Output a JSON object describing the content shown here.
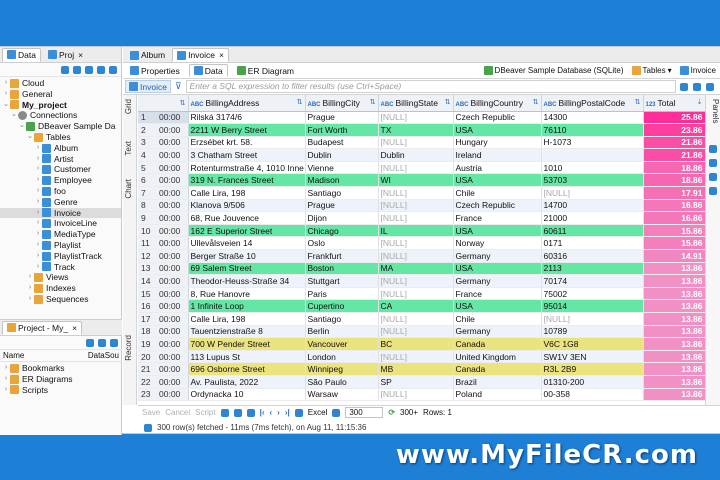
{
  "left_panel": {
    "tabs": [
      {
        "label": "Data"
      },
      {
        "label": "Proj"
      }
    ],
    "tree": [
      {
        "label": "Cloud",
        "indent": 0,
        "arrow": "›",
        "icon": "folder"
      },
      {
        "label": "General",
        "indent": 0,
        "arrow": "›",
        "icon": "folder"
      },
      {
        "label": "My_project",
        "indent": 0,
        "arrow": "⌄",
        "icon": "folder",
        "bold": true
      },
      {
        "label": "Connections",
        "indent": 1,
        "arrow": "⌄",
        "icon": "db"
      },
      {
        "label": "DBeaver Sample Da",
        "indent": 2,
        "arrow": "⌄",
        "icon": "green"
      },
      {
        "label": "Tables",
        "indent": 3,
        "arrow": "⌄",
        "icon": "folder"
      },
      {
        "label": "Album",
        "indent": 4,
        "arrow": "›",
        "icon": "table"
      },
      {
        "label": "Artist",
        "indent": 4,
        "arrow": "›",
        "icon": "table"
      },
      {
        "label": "Customer",
        "indent": 4,
        "arrow": "›",
        "icon": "table"
      },
      {
        "label": "Employee",
        "indent": 4,
        "arrow": "›",
        "icon": "table"
      },
      {
        "label": "foo",
        "indent": 4,
        "arrow": "›",
        "icon": "table"
      },
      {
        "label": "Genre",
        "indent": 4,
        "arrow": "›",
        "icon": "table"
      },
      {
        "label": "Invoice",
        "indent": 4,
        "arrow": "›",
        "icon": "table",
        "selected": true
      },
      {
        "label": "InvoiceLine",
        "indent": 4,
        "arrow": "›",
        "icon": "table"
      },
      {
        "label": "MediaType",
        "indent": 4,
        "arrow": "›",
        "icon": "table"
      },
      {
        "label": "Playlist",
        "indent": 4,
        "arrow": "›",
        "icon": "table"
      },
      {
        "label": "PlaylistTrack",
        "indent": 4,
        "arrow": "›",
        "icon": "table"
      },
      {
        "label": "Track",
        "indent": 4,
        "arrow": "›",
        "icon": "table"
      },
      {
        "label": "Views",
        "indent": 3,
        "arrow": "›",
        "icon": "folder"
      },
      {
        "label": "Indexes",
        "indent": 3,
        "arrow": "›",
        "icon": "folder"
      },
      {
        "label": "Sequences",
        "indent": 3,
        "arrow": "›",
        "icon": "folder"
      }
    ]
  },
  "project_panel": {
    "tab": "Project - My_",
    "col_name": "Name",
    "col_ds": "DataSou",
    "items": [
      {
        "label": "Bookmarks"
      },
      {
        "label": "ER Diagrams"
      },
      {
        "label": "Scripts"
      }
    ]
  },
  "editor": {
    "tabs": [
      {
        "label": "Album"
      },
      {
        "label": "Invoice"
      }
    ],
    "subtabs": [
      {
        "label": "Properties"
      },
      {
        "label": "Data"
      },
      {
        "label": "ER Diagram"
      }
    ],
    "datasource": "DBeaver Sample Database (SQLite)",
    "tables_label": "Tables",
    "invoice_label": "Invoice",
    "filter_label": "Invoice",
    "filter_placeholder": "Enter a SQL expression to filter results (use Ctrl+Space)"
  },
  "side_tabs": {
    "grid": "Grid",
    "text": "Text",
    "chart": "Chart",
    "record": "Record",
    "panels": "Panels"
  },
  "columns": [
    "",
    "BillingAddress",
    "BillingCity",
    "BillingState",
    "BillingCountry",
    "BillingPostalCode",
    "Total"
  ],
  "rows": [
    {
      "n": "1",
      "t": "00:00",
      "addr": "Rilská 3174/6",
      "city": "Prague",
      "state": "[NULL]",
      "country": "Czech Republic",
      "postal": "14300",
      "total": "25.86",
      "color": "pink"
    },
    {
      "n": "2",
      "t": "00:00",
      "addr": "2211 W Berry Street",
      "city": "Fort Worth",
      "state": "TX",
      "country": "USA",
      "postal": "76110",
      "total": "23.86",
      "color": "green"
    },
    {
      "n": "3",
      "t": "00:00",
      "addr": "Erzsébet krt. 58.",
      "city": "Budapest",
      "state": "[NULL]",
      "country": "Hungary",
      "postal": "H-1073",
      "total": "21.86",
      "color": "none"
    },
    {
      "n": "4",
      "t": "00:00",
      "addr": "3 Chatham Street",
      "city": "Dublin",
      "state": "Dublin",
      "country": "Ireland",
      "postal": "",
      "total": "21.86",
      "color": "none"
    },
    {
      "n": "5",
      "t": "00:00",
      "addr": "Rotenturmstraße 4, 1010 Inne",
      "city": "Vienne",
      "state": "[NULL]",
      "country": "Austria",
      "postal": "1010",
      "total": "18.86",
      "color": "none"
    },
    {
      "n": "6",
      "t": "00:00",
      "addr": "319 N. Frances Street",
      "city": "Madison",
      "state": "WI",
      "country": "USA",
      "postal": "53703",
      "total": "18.86",
      "color": "green"
    },
    {
      "n": "7",
      "t": "00:00",
      "addr": "Calle Lira, 198",
      "city": "Santiago",
      "state": "[NULL]",
      "country": "Chile",
      "postal": "[NULL]",
      "total": "17.91",
      "color": "none"
    },
    {
      "n": "8",
      "t": "00:00",
      "addr": "Klanova 9/506",
      "city": "Prague",
      "state": "[NULL]",
      "country": "Czech Republic",
      "postal": "14700",
      "total": "16.86",
      "color": "none"
    },
    {
      "n": "9",
      "t": "00:00",
      "addr": "68, Rue Jouvence",
      "city": "Dijon",
      "state": "[NULL]",
      "country": "France",
      "postal": "21000",
      "total": "16.86",
      "color": "none"
    },
    {
      "n": "10",
      "t": "00:00",
      "addr": "162 E Superior Street",
      "city": "Chicago",
      "state": "IL",
      "country": "USA",
      "postal": "60611",
      "total": "15.86",
      "color": "green"
    },
    {
      "n": "11",
      "t": "00:00",
      "addr": "Ullevålsveien 14",
      "city": "Oslo",
      "state": "[NULL]",
      "country": "Norway",
      "postal": "0171",
      "total": "15.86",
      "color": "none"
    },
    {
      "n": "12",
      "t": "00:00",
      "addr": "Berger Straße 10",
      "city": "Frankfurt",
      "state": "[NULL]",
      "country": "Germany",
      "postal": "60316",
      "total": "14.91",
      "color": "none"
    },
    {
      "n": "13",
      "t": "00:00",
      "addr": "69 Salem Street",
      "city": "Boston",
      "state": "MA",
      "country": "USA",
      "postal": "2113",
      "total": "13.86",
      "color": "green"
    },
    {
      "n": "14",
      "t": "00:00",
      "addr": "Theodor-Heuss-Straße 34",
      "city": "Stuttgart",
      "state": "[NULL]",
      "country": "Germany",
      "postal": "70174",
      "total": "13.86",
      "color": "none"
    },
    {
      "n": "15",
      "t": "00:00",
      "addr": "8, Rue Hanovre",
      "city": "Paris",
      "state": "[NULL]",
      "country": "France",
      "postal": "75002",
      "total": "13.86",
      "color": "none"
    },
    {
      "n": "16",
      "t": "00:00",
      "addr": "1 Infinite Loop",
      "city": "Cupertino",
      "state": "CA",
      "country": "USA",
      "postal": "95014",
      "total": "13.86",
      "color": "green"
    },
    {
      "n": "17",
      "t": "00:00",
      "addr": "Calle Lira, 198",
      "city": "Santiago",
      "state": "[NULL]",
      "country": "Chile",
      "postal": "[NULL]",
      "total": "13.86",
      "color": "none"
    },
    {
      "n": "18",
      "t": "00:00",
      "addr": "Tauentzienstraße 8",
      "city": "Berlin",
      "state": "[NULL]",
      "country": "Germany",
      "postal": "10789",
      "total": "13.86",
      "color": "none"
    },
    {
      "n": "19",
      "t": "00:00",
      "addr": "700 W Pender Street",
      "city": "Vancouver",
      "state": "BC",
      "country": "Canada",
      "postal": "V6C 1G8",
      "total": "13.86",
      "color": "yellow"
    },
    {
      "n": "20",
      "t": "00:00",
      "addr": "113 Lupus St",
      "city": "London",
      "state": "[NULL]",
      "country": "United Kingdom",
      "postal": "SW1V 3EN",
      "total": "13.86",
      "color": "none"
    },
    {
      "n": "21",
      "t": "00:00",
      "addr": "696 Osborne Street",
      "city": "Winnipeg",
      "state": "MB",
      "country": "Canada",
      "postal": "R3L 2B9",
      "total": "13.86",
      "color": "yellow"
    },
    {
      "n": "22",
      "t": "00:00",
      "addr": "Av. Paulista, 2022",
      "city": "São Paulo",
      "state": "SP",
      "country": "Brazil",
      "postal": "01310-200",
      "total": "13.86",
      "color": "none"
    },
    {
      "n": "23",
      "t": "00:00",
      "addr": "Ordynacka 10",
      "city": "Warsaw",
      "state": "[NULL]",
      "country": "Poland",
      "postal": "00-358",
      "total": "13.86",
      "color": "none"
    }
  ],
  "colors": {
    "total_max": "#ff2d97",
    "total_min": "#f090c4",
    "green_row": "#64e6a4",
    "yellow_row": "#ebe37e"
  },
  "toolbar": {
    "save": "Save",
    "cancel": "Cancel",
    "script": "Script",
    "excel": "Excel",
    "fetch_size": "300",
    "fetch_all": "300+",
    "rows": "Rows: 1"
  },
  "status": {
    "text": "300 row(s) fetched - 11ms (7ms fetch), on Aug 11, 11:15:36"
  },
  "watermark": "www.MyFileCR.com"
}
